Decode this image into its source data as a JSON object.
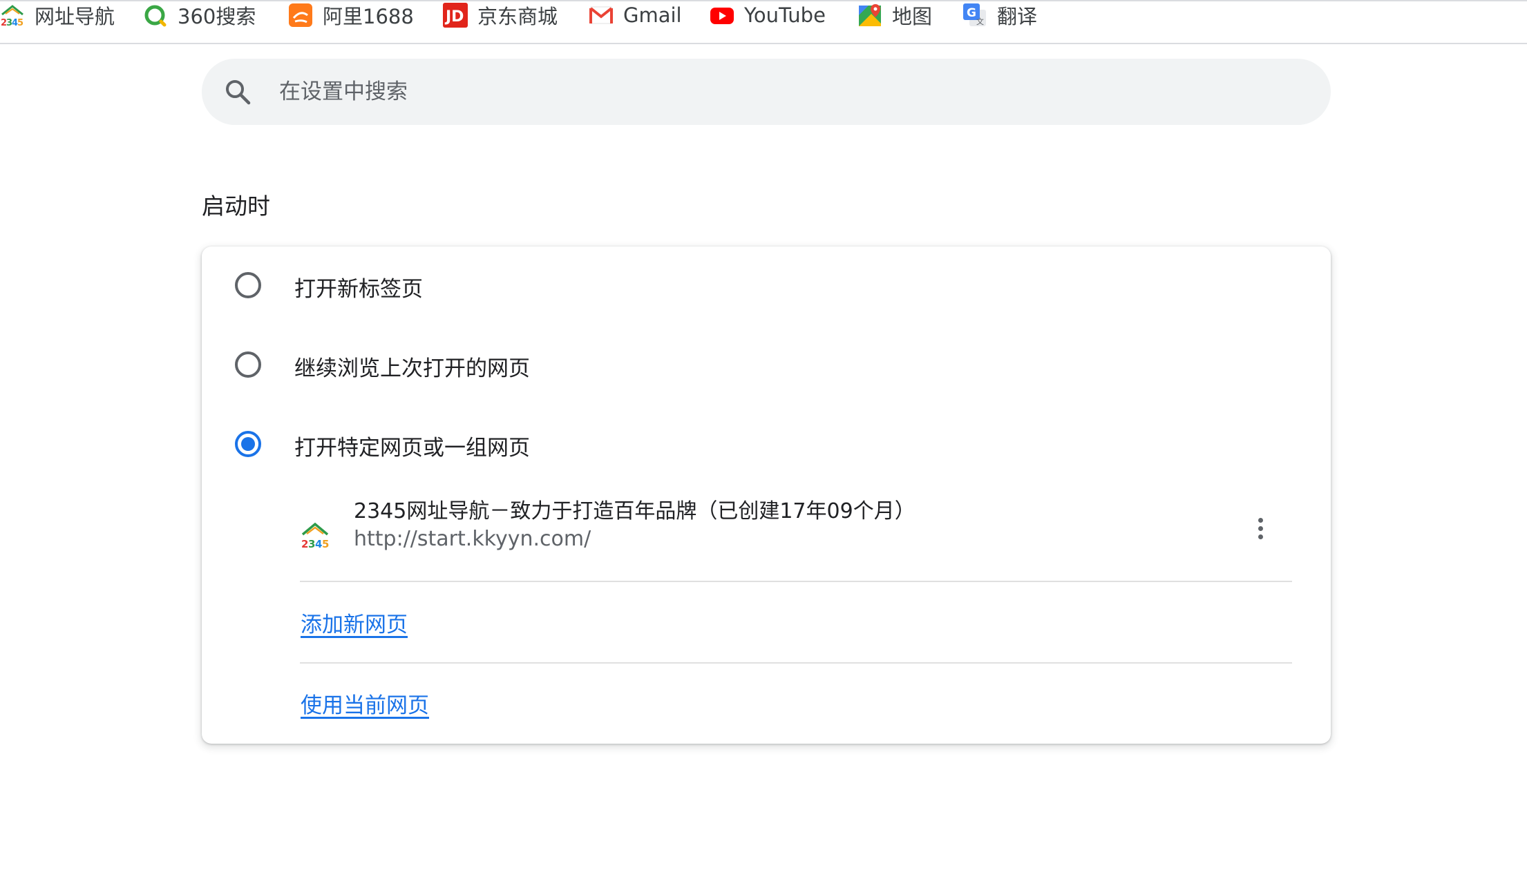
{
  "bookmarks": [
    {
      "label": "网址导航",
      "icon": "2345-house-icon"
    },
    {
      "label": "360搜索",
      "icon": "360-search-icon"
    },
    {
      "label": "阿里1688",
      "icon": "ali-1688-icon"
    },
    {
      "label": "京东商城",
      "icon": "jd-icon"
    },
    {
      "label": "Gmail",
      "icon": "gmail-icon"
    },
    {
      "label": "YouTube",
      "icon": "youtube-icon"
    },
    {
      "label": "地图",
      "icon": "maps-icon"
    },
    {
      "label": "翻译",
      "icon": "translate-icon"
    }
  ],
  "search": {
    "placeholder": "在设置中搜索",
    "value": ""
  },
  "startup": {
    "title": "启动时",
    "options": [
      {
        "label": "打开新标签页",
        "checked": false
      },
      {
        "label": "继续浏览上次打开的网页",
        "checked": false
      },
      {
        "label": "打开特定网页或一组网页",
        "checked": true
      }
    ],
    "pages": [
      {
        "title": "2345网址导航－致力于打造百年品牌（已创建17年09个月）",
        "url": "http://start.kkyyn.com/",
        "icon": "2345-house-icon"
      }
    ],
    "add_page_label": "添加新网页",
    "use_current_label": "使用当前网页"
  },
  "colors": {
    "accent": "#1a73e8",
    "text_primary": "#202124",
    "text_secondary": "#5f6368",
    "search_bg": "#f1f3f4"
  }
}
